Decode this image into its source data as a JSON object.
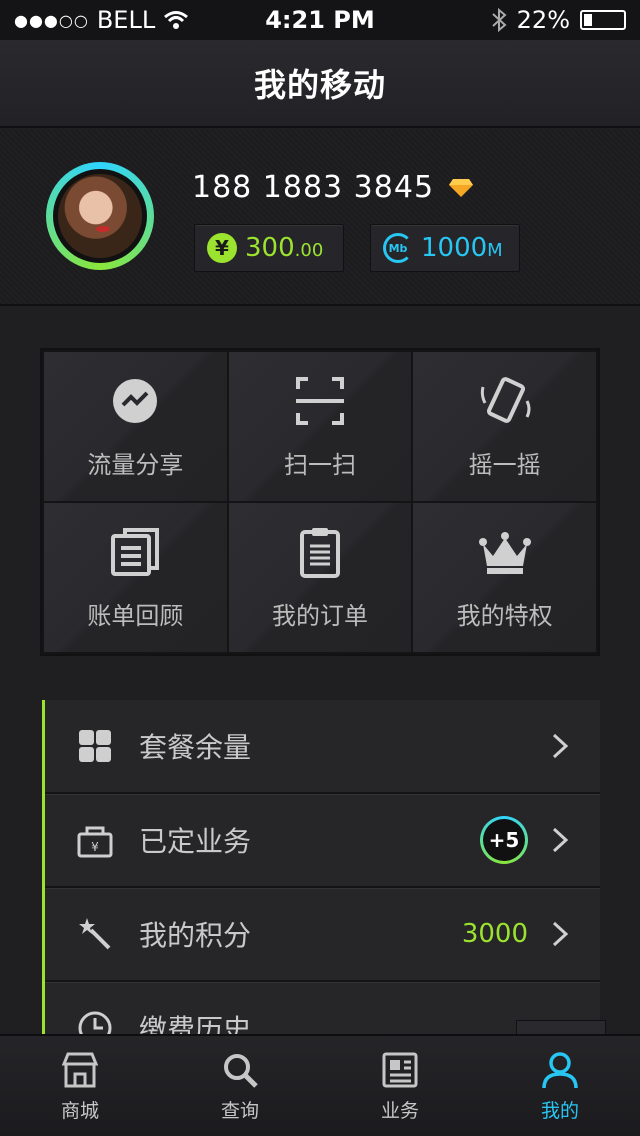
{
  "status_bar": {
    "signal": "●●●○○",
    "carrier": "BELL",
    "time": "4:21 PM",
    "battery_percent": "22%",
    "battery_level": 0.22
  },
  "header": {
    "title": "我的移动"
  },
  "profile": {
    "phone": "188 1883 3845",
    "balance_main": "300",
    "balance_decimal": ".00",
    "data_main": "1000",
    "data_unit": "M",
    "mb_icon_text": "Mb",
    "yen_symbol": "¥"
  },
  "grid": {
    "items": [
      {
        "label": "流量分享",
        "icon": "share-check-icon"
      },
      {
        "label": "扫一扫",
        "icon": "scan-icon"
      },
      {
        "label": "摇一摇",
        "icon": "shake-phone-icon"
      },
      {
        "label": "账单回顾",
        "icon": "bill-icon"
      },
      {
        "label": "我的订单",
        "icon": "clipboard-icon"
      },
      {
        "label": "我的特权",
        "icon": "crown-icon"
      }
    ]
  },
  "list": {
    "items": [
      {
        "label": "套餐余量",
        "icon": "grid-icon"
      },
      {
        "label": "已定业务",
        "icon": "briefcase-yen-icon",
        "badge": "+5"
      },
      {
        "label": "我的积分",
        "icon": "magic-wand-icon",
        "value": "3000"
      },
      {
        "label": "缴费历史",
        "icon": "clock-icon"
      }
    ]
  },
  "tabs": [
    {
      "label": "商城",
      "icon": "store-icon"
    },
    {
      "label": "查询",
      "icon": "search-icon"
    },
    {
      "label": "业务",
      "icon": "news-icon"
    },
    {
      "label": "我的",
      "icon": "user-icon",
      "active": true
    }
  ],
  "colors": {
    "accent_green": "#9be32f",
    "accent_blue": "#27c6f3",
    "background": "#1f1f22"
  }
}
